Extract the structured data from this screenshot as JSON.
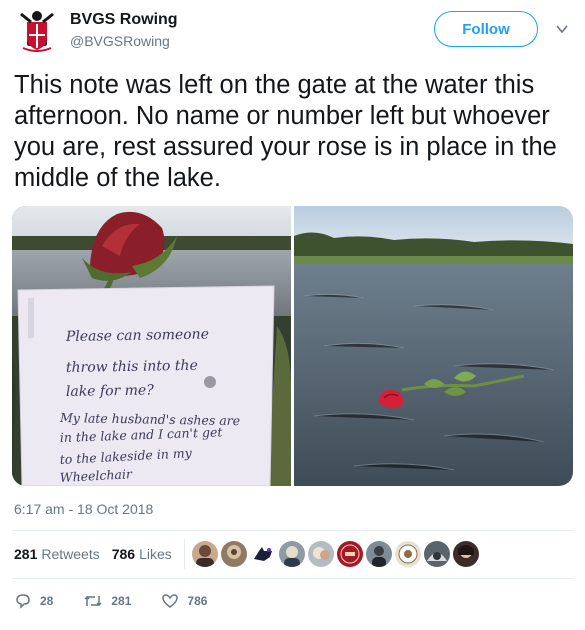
{
  "account": {
    "name": "BVGS Rowing",
    "handle": "@BVGSRowing",
    "follow_label": "Follow"
  },
  "tweet": {
    "text": "This note was left on the gate at the water this afternoon. No name or number left but whoever you are, rest assured your rose is in place in the middle of the lake.",
    "timestamp": "6:17 am - 18 Oct 2018"
  },
  "note": {
    "lines": [
      "Please can someone",
      "throw this into the",
      "lake for me?",
      "My late husband's ashes are",
      "in the lake and I can't get",
      "to the lakeside in my",
      "Wheelchair"
    ]
  },
  "stats": {
    "retweets_count": "281",
    "retweets_label": "Retweets",
    "likes_count": "786",
    "likes_label": "Likes"
  },
  "actions": {
    "reply_count": "28",
    "retweet_count": "281",
    "like_count": "786"
  },
  "colors": {
    "accent": "#1da1f2",
    "muted": "#657786",
    "divider": "#e6ecf0"
  }
}
